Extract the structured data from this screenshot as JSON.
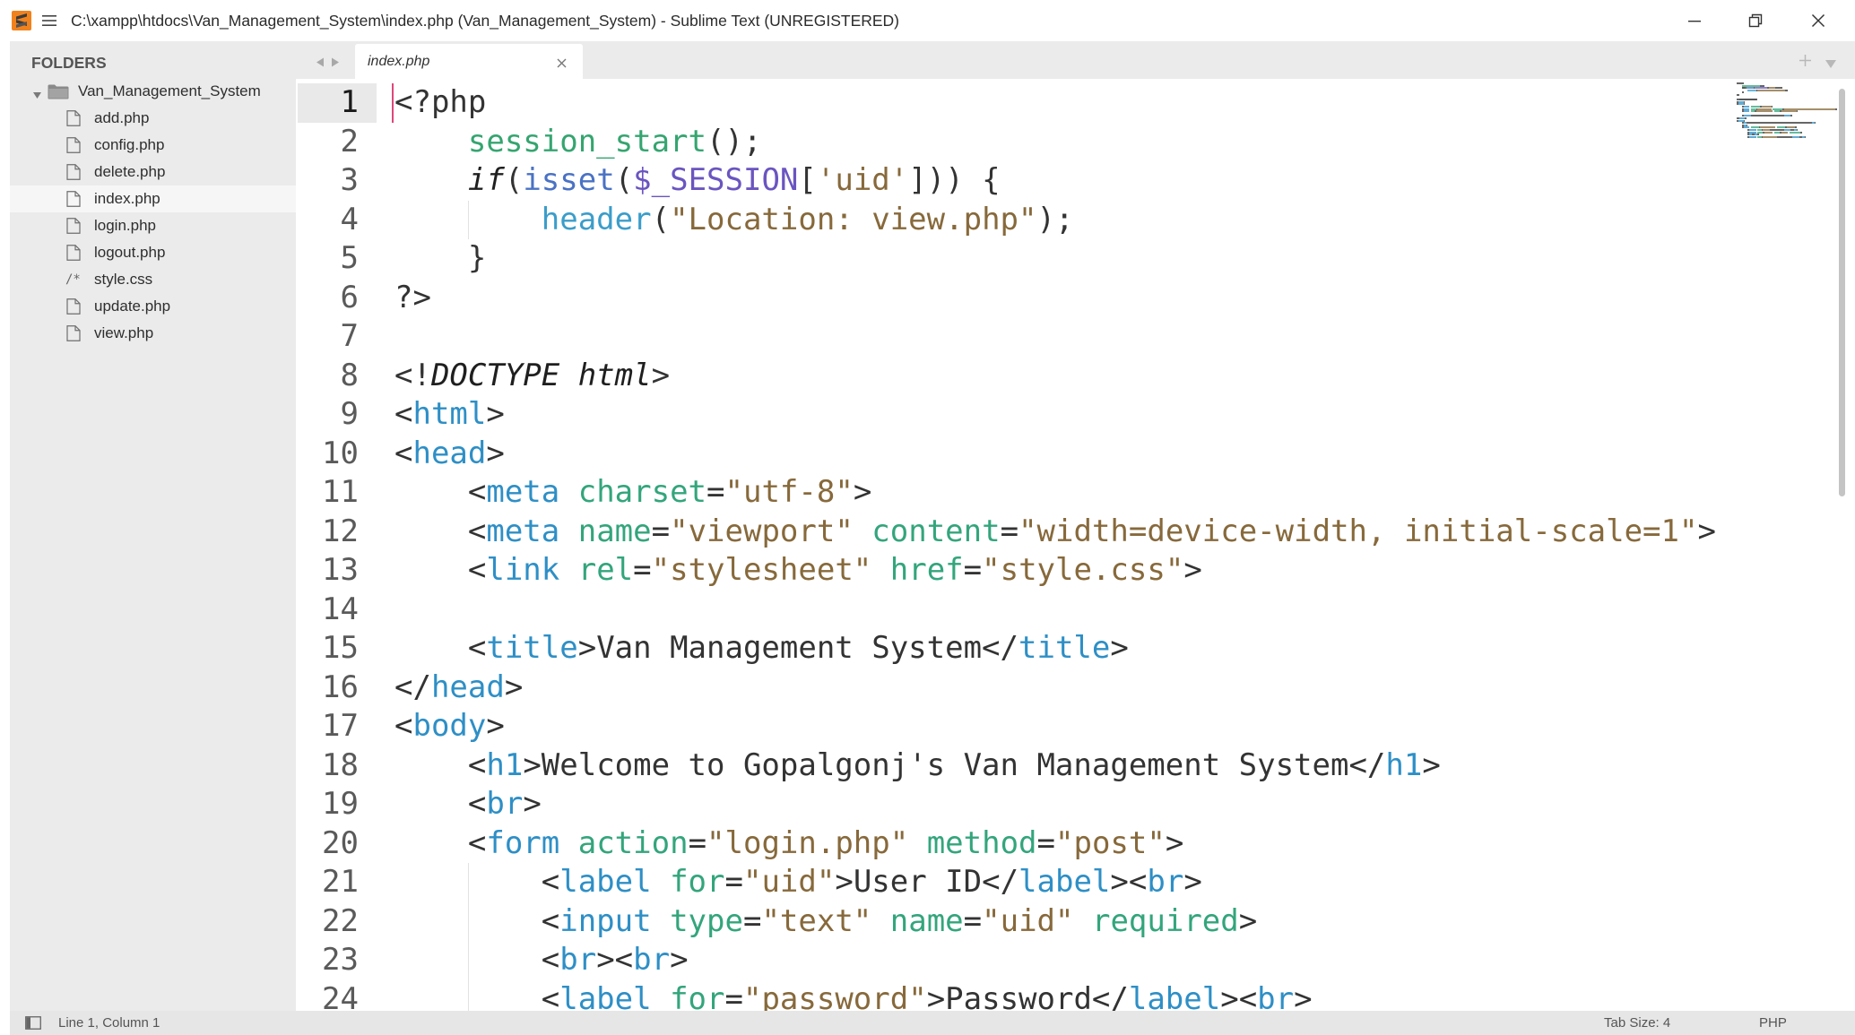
{
  "window": {
    "title": "C:\\xampp\\htdocs\\Van_Management_System\\index.php (Van_Management_System) - Sublime Text (UNREGISTERED)",
    "app_icon": "sublime-text-icon",
    "menu_icon": "hamburger-menu-icon",
    "controls": {
      "minimize": "minimize-icon",
      "restore": "restore-icon",
      "close": "close-icon"
    }
  },
  "sidebar": {
    "header": "FOLDERS",
    "root_folder": {
      "name": "Van_Management_System",
      "expanded": true,
      "icon": "folder-icon"
    },
    "files": [
      {
        "name": "add.php",
        "icon": "file-icon"
      },
      {
        "name": "config.php",
        "icon": "file-icon"
      },
      {
        "name": "delete.php",
        "icon": "file-icon"
      },
      {
        "name": "index.php",
        "icon": "file-icon",
        "selected": true
      },
      {
        "name": "login.php",
        "icon": "file-icon"
      },
      {
        "name": "logout.php",
        "icon": "file-icon"
      },
      {
        "name": "style.css",
        "icon": "comment-glyph-icon",
        "icon_text": "/*"
      },
      {
        "name": "update.php",
        "icon": "file-icon"
      },
      {
        "name": "view.php",
        "icon": "file-icon"
      }
    ]
  },
  "tabs": {
    "nav_icons": [
      "tab-back-arrow-icon",
      "tab-forward-arrow-icon"
    ],
    "items": [
      {
        "label": "index.php",
        "active": true,
        "close_icon": "close-icon"
      }
    ],
    "new_tab_icon": "plus-icon",
    "tab_menu_icon": "chevron-down-icon"
  },
  "editor": {
    "cursor": {
      "line": 1,
      "column": 1,
      "color": "#e0457b"
    },
    "lines": [
      {
        "n": "1",
        "active": true,
        "tokens": [
          {
            "t": "<?php",
            "c": "#333333"
          }
        ]
      },
      {
        "n": "2",
        "tokens": [
          {
            "t": "    ",
            "c": "#333333"
          },
          {
            "t": "session_start",
            "c": "#35a570"
          },
          {
            "t": "();",
            "c": "#333333"
          }
        ]
      },
      {
        "n": "3",
        "tokens": [
          {
            "t": "    ",
            "c": "#333333"
          },
          {
            "t": "if",
            "c": "#1f1f1f",
            "i": true
          },
          {
            "t": "(",
            "c": "#333333"
          },
          {
            "t": "isset",
            "c": "#4a72c4"
          },
          {
            "t": "(",
            "c": "#333333"
          },
          {
            "t": "$_SESSION",
            "c": "#6a55c0"
          },
          {
            "t": "[",
            "c": "#333333"
          },
          {
            "t": "'uid'",
            "c": "#87693b"
          },
          {
            "t": "])) {",
            "c": "#333333"
          }
        ]
      },
      {
        "n": "4",
        "tokens": [
          {
            "t": "        ",
            "c": "#333333"
          },
          {
            "t": "header",
            "c": "#3b9dca"
          },
          {
            "t": "(",
            "c": "#333333"
          },
          {
            "t": "\"Location: view.php\"",
            "c": "#87693b"
          },
          {
            "t": ");",
            "c": "#333333"
          }
        ]
      },
      {
        "n": "5",
        "tokens": [
          {
            "t": "    }",
            "c": "#333333"
          }
        ]
      },
      {
        "n": "6",
        "tokens": [
          {
            "t": "?>",
            "c": "#333333"
          }
        ]
      },
      {
        "n": "7",
        "tokens": []
      },
      {
        "n": "8",
        "tokens": [
          {
            "t": "<!",
            "c": "#333333"
          },
          {
            "t": "DOCTYPE html",
            "c": "#1f1f1f",
            "i": true
          },
          {
            "t": ">",
            "c": "#333333"
          }
        ]
      },
      {
        "n": "9",
        "tokens": [
          {
            "t": "<",
            "c": "#333333"
          },
          {
            "t": "html",
            "c": "#2e8fc6"
          },
          {
            "t": ">",
            "c": "#333333"
          }
        ]
      },
      {
        "n": "10",
        "tokens": [
          {
            "t": "<",
            "c": "#333333"
          },
          {
            "t": "head",
            "c": "#2e8fc6"
          },
          {
            "t": ">",
            "c": "#333333"
          }
        ]
      },
      {
        "n": "11",
        "tokens": [
          {
            "t": "    <",
            "c": "#333333"
          },
          {
            "t": "meta",
            "c": "#2e8fc6"
          },
          {
            "t": " ",
            "c": "#333333"
          },
          {
            "t": "charset",
            "c": "#33a57c"
          },
          {
            "t": "=",
            "c": "#333333"
          },
          {
            "t": "\"utf-8\"",
            "c": "#87693b"
          },
          {
            "t": ">",
            "c": "#333333"
          }
        ]
      },
      {
        "n": "12",
        "tokens": [
          {
            "t": "    <",
            "c": "#333333"
          },
          {
            "t": "meta",
            "c": "#2e8fc6"
          },
          {
            "t": " ",
            "c": "#333333"
          },
          {
            "t": "name",
            "c": "#33a57c"
          },
          {
            "t": "=",
            "c": "#333333"
          },
          {
            "t": "\"viewport\"",
            "c": "#87693b"
          },
          {
            "t": " ",
            "c": "#333333"
          },
          {
            "t": "content",
            "c": "#33a57c"
          },
          {
            "t": "=",
            "c": "#333333"
          },
          {
            "t": "\"width=device-width, initial-scale=1\"",
            "c": "#87693b"
          },
          {
            "t": ">",
            "c": "#333333"
          }
        ]
      },
      {
        "n": "13",
        "tokens": [
          {
            "t": "    <",
            "c": "#333333"
          },
          {
            "t": "link",
            "c": "#2e8fc6"
          },
          {
            "t": " ",
            "c": "#333333"
          },
          {
            "t": "rel",
            "c": "#33a57c"
          },
          {
            "t": "=",
            "c": "#333333"
          },
          {
            "t": "\"stylesheet\"",
            "c": "#87693b"
          },
          {
            "t": " ",
            "c": "#333333"
          },
          {
            "t": "href",
            "c": "#33a57c"
          },
          {
            "t": "=",
            "c": "#333333"
          },
          {
            "t": "\"style.css\"",
            "c": "#87693b"
          },
          {
            "t": ">",
            "c": "#333333"
          }
        ]
      },
      {
        "n": "14",
        "tokens": []
      },
      {
        "n": "15",
        "tokens": [
          {
            "t": "    <",
            "c": "#333333"
          },
          {
            "t": "title",
            "c": "#2e8fc6"
          },
          {
            "t": ">Van Management System</",
            "c": "#333333"
          },
          {
            "t": "title",
            "c": "#2e8fc6"
          },
          {
            "t": ">",
            "c": "#333333"
          }
        ]
      },
      {
        "n": "16",
        "tokens": [
          {
            "t": "</",
            "c": "#333333"
          },
          {
            "t": "head",
            "c": "#2e8fc6"
          },
          {
            "t": ">",
            "c": "#333333"
          }
        ]
      },
      {
        "n": "17",
        "tokens": [
          {
            "t": "<",
            "c": "#333333"
          },
          {
            "t": "body",
            "c": "#2e8fc6"
          },
          {
            "t": ">",
            "c": "#333333"
          }
        ]
      },
      {
        "n": "18",
        "tokens": [
          {
            "t": "    <",
            "c": "#333333"
          },
          {
            "t": "h1",
            "c": "#2e8fc6"
          },
          {
            "t": ">Welcome to Gopalgonj's Van Management System</",
            "c": "#333333"
          },
          {
            "t": "h1",
            "c": "#2e8fc6"
          },
          {
            "t": ">",
            "c": "#333333"
          }
        ]
      },
      {
        "n": "19",
        "tokens": [
          {
            "t": "    <",
            "c": "#333333"
          },
          {
            "t": "br",
            "c": "#2e8fc6"
          },
          {
            "t": ">",
            "c": "#333333"
          }
        ]
      },
      {
        "n": "20",
        "tokens": [
          {
            "t": "    <",
            "c": "#333333"
          },
          {
            "t": "form",
            "c": "#2e8fc6"
          },
          {
            "t": " ",
            "c": "#333333"
          },
          {
            "t": "action",
            "c": "#33a57c"
          },
          {
            "t": "=",
            "c": "#333333"
          },
          {
            "t": "\"login.php\"",
            "c": "#87693b"
          },
          {
            "t": " ",
            "c": "#333333"
          },
          {
            "t": "method",
            "c": "#33a57c"
          },
          {
            "t": "=",
            "c": "#333333"
          },
          {
            "t": "\"post\"",
            "c": "#87693b"
          },
          {
            "t": ">",
            "c": "#333333"
          }
        ]
      },
      {
        "n": "21",
        "tokens": [
          {
            "t": "        <",
            "c": "#333333"
          },
          {
            "t": "label",
            "c": "#2e8fc6"
          },
          {
            "t": " ",
            "c": "#333333"
          },
          {
            "t": "for",
            "c": "#33a57c"
          },
          {
            "t": "=",
            "c": "#333333"
          },
          {
            "t": "\"uid\"",
            "c": "#87693b"
          },
          {
            "t": ">User ID</",
            "c": "#333333"
          },
          {
            "t": "label",
            "c": "#2e8fc6"
          },
          {
            "t": "><",
            "c": "#333333"
          },
          {
            "t": "br",
            "c": "#2e8fc6"
          },
          {
            "t": ">",
            "c": "#333333"
          }
        ]
      },
      {
        "n": "22",
        "tokens": [
          {
            "t": "        <",
            "c": "#333333"
          },
          {
            "t": "input",
            "c": "#2e8fc6"
          },
          {
            "t": " ",
            "c": "#333333"
          },
          {
            "t": "type",
            "c": "#33a57c"
          },
          {
            "t": "=",
            "c": "#333333"
          },
          {
            "t": "\"text\"",
            "c": "#87693b"
          },
          {
            "t": " ",
            "c": "#333333"
          },
          {
            "t": "name",
            "c": "#33a57c"
          },
          {
            "t": "=",
            "c": "#333333"
          },
          {
            "t": "\"uid\"",
            "c": "#87693b"
          },
          {
            "t": " ",
            "c": "#333333"
          },
          {
            "t": "required",
            "c": "#33a57c"
          },
          {
            "t": ">",
            "c": "#333333"
          }
        ]
      },
      {
        "n": "23",
        "tokens": [
          {
            "t": "        <",
            "c": "#333333"
          },
          {
            "t": "br",
            "c": "#2e8fc6"
          },
          {
            "t": "><",
            "c": "#333333"
          },
          {
            "t": "br",
            "c": "#2e8fc6"
          },
          {
            "t": ">",
            "c": "#333333"
          }
        ]
      },
      {
        "n": "24",
        "tokens": [
          {
            "t": "        <",
            "c": "#333333"
          },
          {
            "t": "label",
            "c": "#2e8fc6"
          },
          {
            "t": " ",
            "c": "#333333"
          },
          {
            "t": "for",
            "c": "#33a57c"
          },
          {
            "t": "=",
            "c": "#333333"
          },
          {
            "t": "\"password\"",
            "c": "#87693b"
          },
          {
            "t": ">Password</",
            "c": "#333333"
          },
          {
            "t": "label",
            "c": "#2e8fc6"
          },
          {
            "t": "><",
            "c": "#333333"
          },
          {
            "t": "br",
            "c": "#2e8fc6"
          },
          {
            "t": ">",
            "c": "#333333"
          }
        ]
      }
    ]
  },
  "status_bar": {
    "panel_icon": "panel-toggle-icon",
    "position": "Line 1, Column 1",
    "tab_size": "Tab Size: 4",
    "syntax": "PHP"
  }
}
